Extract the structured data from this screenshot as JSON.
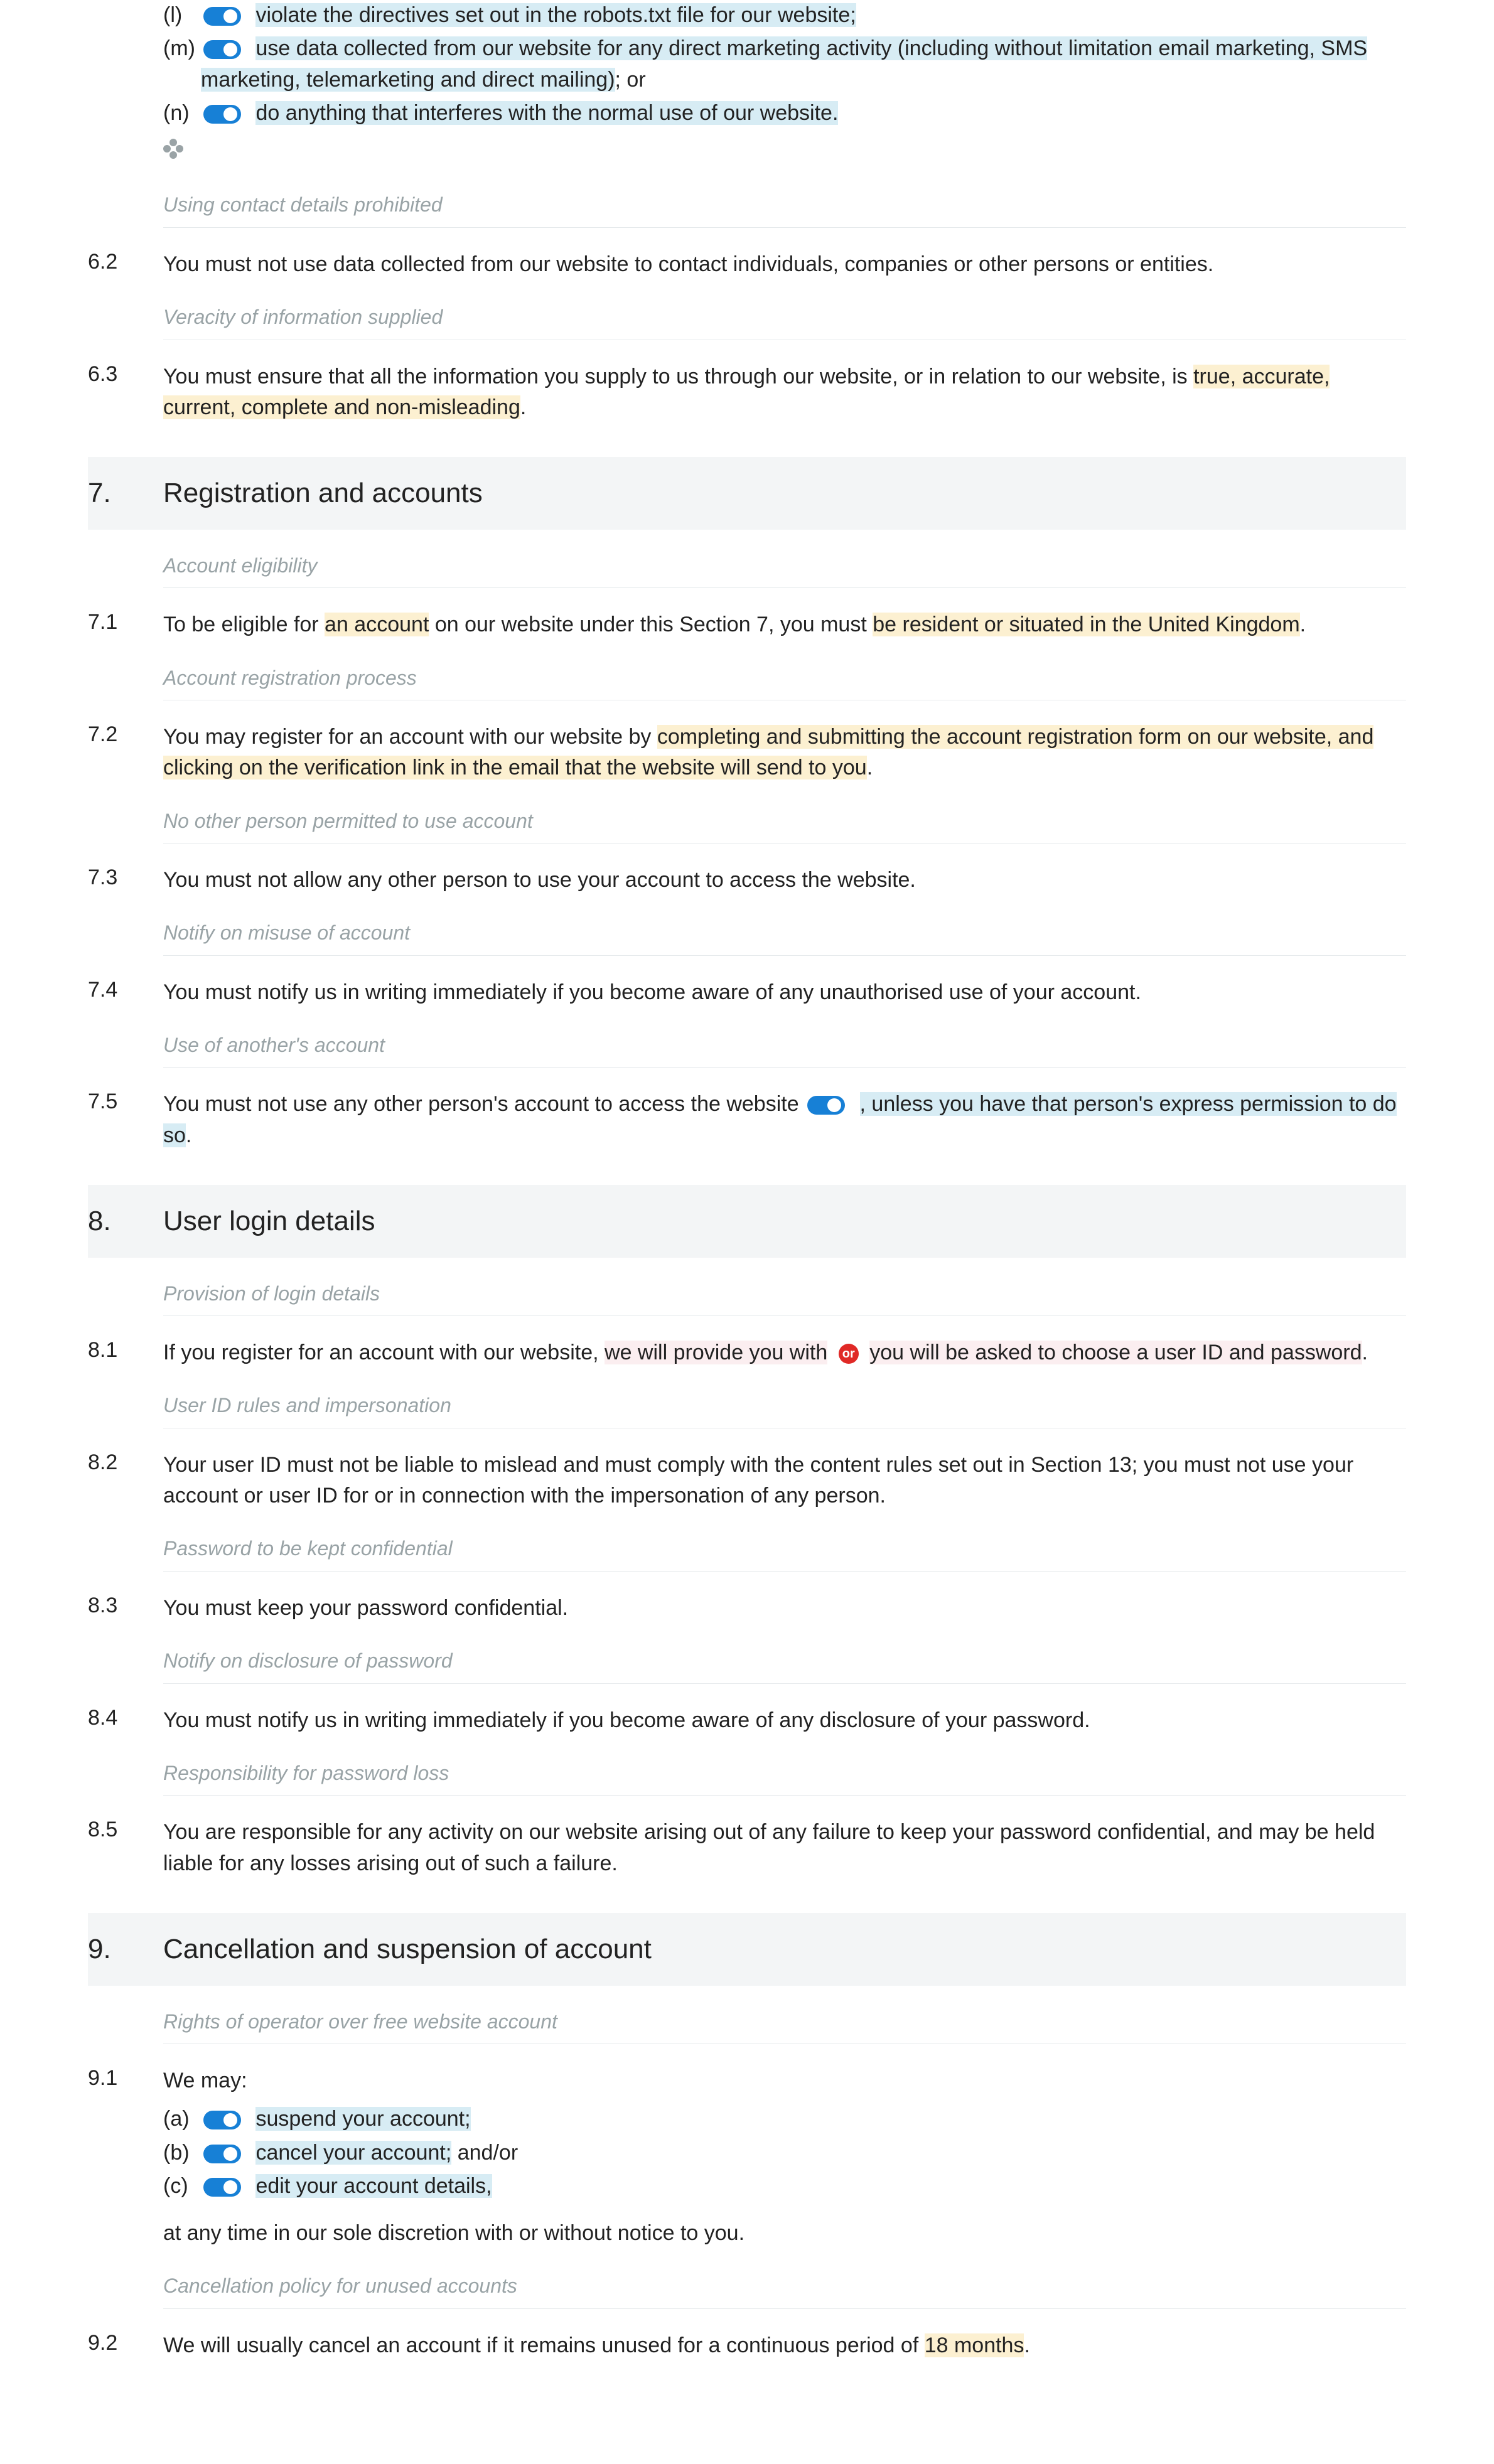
{
  "list6": {
    "items": [
      {
        "letter": "(l)",
        "text": "violate the directives set out in the robots.txt file for our website;"
      },
      {
        "letter": "(m)",
        "text": "use data collected from our website for any direct marketing activity (including without limitation email marketing, SMS marketing, telemarketing and direct mailing)",
        "tail": "; or"
      },
      {
        "letter": "(n)",
        "text": "do anything that interferes with the normal use of our website."
      }
    ]
  },
  "c6_2": {
    "hint": "Using contact details prohibited",
    "num": "6.2",
    "text": "You must not use data collected from our website to contact individuals, companies or other persons or entities."
  },
  "c6_3": {
    "hint": "Veracity of information supplied",
    "num": "6.3",
    "pre": "You must ensure that all the information you supply to us through our website, or in relation to our website, is ",
    "hl": "true, accurate, current, complete and non-misleading",
    "post": "."
  },
  "s7": {
    "num": "7.",
    "title": "Registration and accounts"
  },
  "c7_1": {
    "hint": "Account eligibility",
    "num": "7.1",
    "pre": "To be eligible for ",
    "a": "an account",
    "mid": " on our website under this Section 7, you must ",
    "b": "be resident or situated in the United Kingdom",
    "post": "."
  },
  "c7_2": {
    "hint": "Account registration process",
    "num": "7.2",
    "pre": "You may register for an account with our website by ",
    "hl": "completing and submitting the account registration form on our website, and clicking on the verification link in the email that the website will send to you",
    "post": "."
  },
  "c7_3": {
    "hint": "No other person permitted to use account",
    "num": "7.3",
    "text": "You must not allow any other person to use your account to access the website."
  },
  "c7_4": {
    "hint": "Notify on misuse of account",
    "num": "7.4",
    "text": "You must notify us in writing immediately if you become aware of any unauthorised use of your account."
  },
  "c7_5": {
    "hint": "Use of another's account",
    "num": "7.5",
    "pre": "You must not use any other person's account to access the website",
    "hl": ", unless you have that person's express permission to do so",
    "post": "."
  },
  "s8": {
    "num": "8.",
    "title": "User login details"
  },
  "c8_1": {
    "hint": "Provision of login details",
    "num": "8.1",
    "pre": "If you register for an account with our website, ",
    "a": "we will provide you with",
    "or": "or",
    "b": "you will be asked to choose",
    "mid": " a user ID and password",
    "post": "."
  },
  "c8_2": {
    "hint": "User ID rules and impersonation",
    "num": "8.2",
    "text": "Your user ID must not be liable to mislead and must comply with the content rules set out in Section 13; you must not use your account or user ID for or in connection with the impersonation of any person."
  },
  "c8_3": {
    "hint": "Password to be kept confidential",
    "num": "8.3",
    "text": "You must keep your password confidential."
  },
  "c8_4": {
    "hint": "Notify on disclosure of password",
    "num": "8.4",
    "text": "You must notify us in writing immediately if you become aware of any disclosure of your password."
  },
  "c8_5": {
    "hint": "Responsibility for password loss",
    "num": "8.5",
    "text": "You are responsible for any activity on our website arising out of any failure to keep your password confidential, and may be held liable for any losses arising out of such a failure."
  },
  "s9": {
    "num": "9.",
    "title": "Cancellation and suspension of account"
  },
  "c9_1": {
    "hint": "Rights of operator over free website account",
    "num": "9.1",
    "intro": "We may:",
    "items": [
      {
        "letter": "(a)",
        "text": "suspend your account;"
      },
      {
        "letter": "(b)",
        "text": "cancel your account;",
        "tail": " and/or"
      },
      {
        "letter": "(c)",
        "text": "edit your account details,"
      }
    ],
    "outro": "at any time in our sole discretion with or without notice to you."
  },
  "c9_2": {
    "hint": "Cancellation policy for unused accounts",
    "num": "9.2",
    "pre": "We will usually cancel an account if it remains unused for a continuous period of ",
    "hl": "18 months",
    "post": "."
  }
}
